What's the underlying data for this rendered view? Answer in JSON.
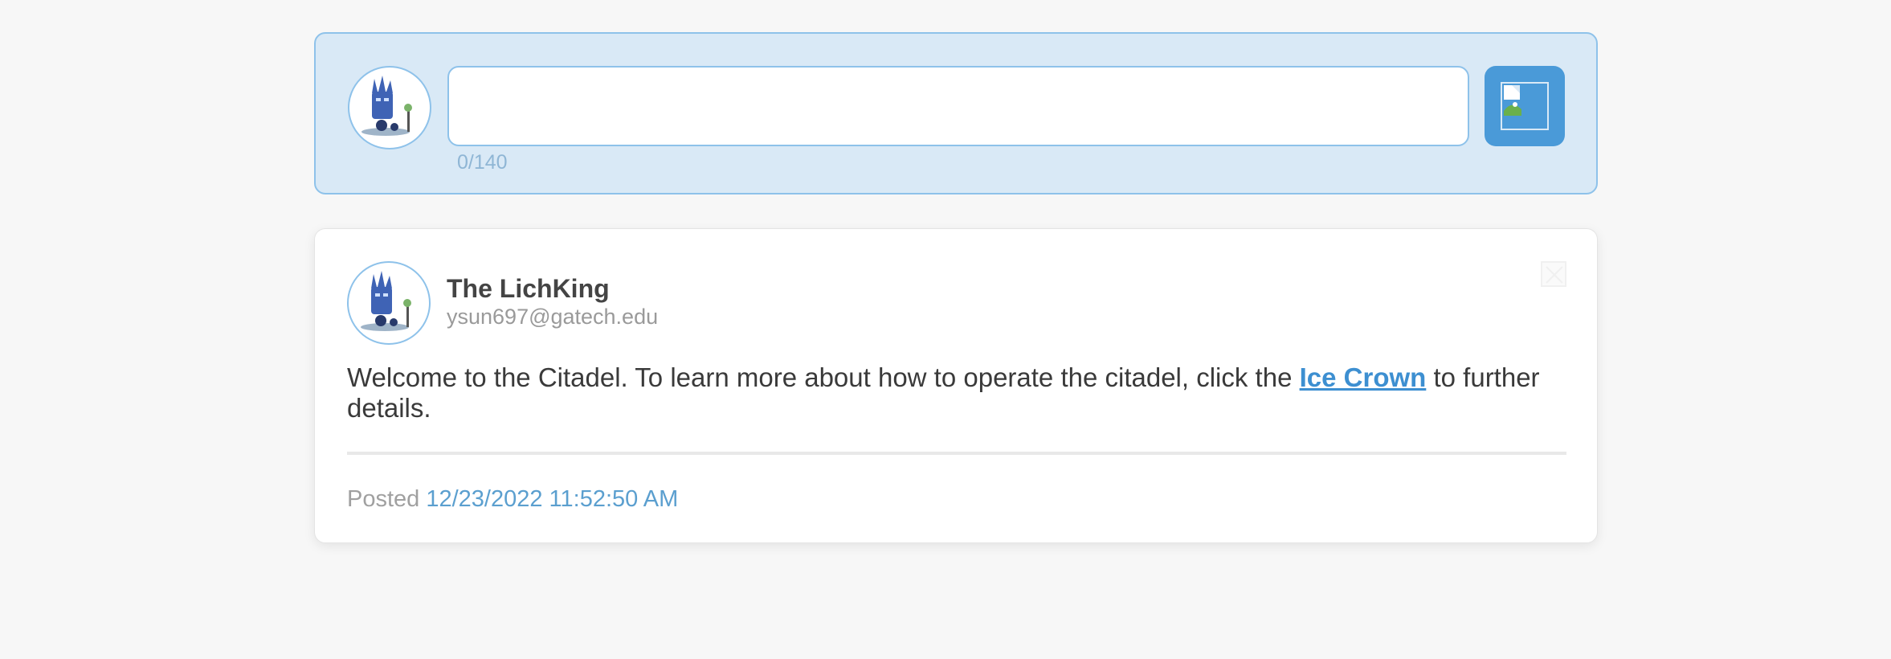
{
  "composer": {
    "input_value": "",
    "counter": "0/140",
    "image_button_icon": "image-icon"
  },
  "post": {
    "author_name": "The LichKing",
    "author_email": "ysun697@gatech.edu",
    "body_before": "Welcome to the Citadel. To learn more about how to operate the citadel, click the ",
    "link_text": "Ice Crown",
    "body_after": " to further details.",
    "posted_label": "Posted",
    "posted_time": "12/23/2022 11:52:50 AM",
    "close_icon": "close-icon"
  },
  "colors": {
    "accent": "#4a9ad8",
    "composer_bg": "#d9e9f6",
    "border": "#8ec2ea",
    "link": "#3d8fd1"
  }
}
